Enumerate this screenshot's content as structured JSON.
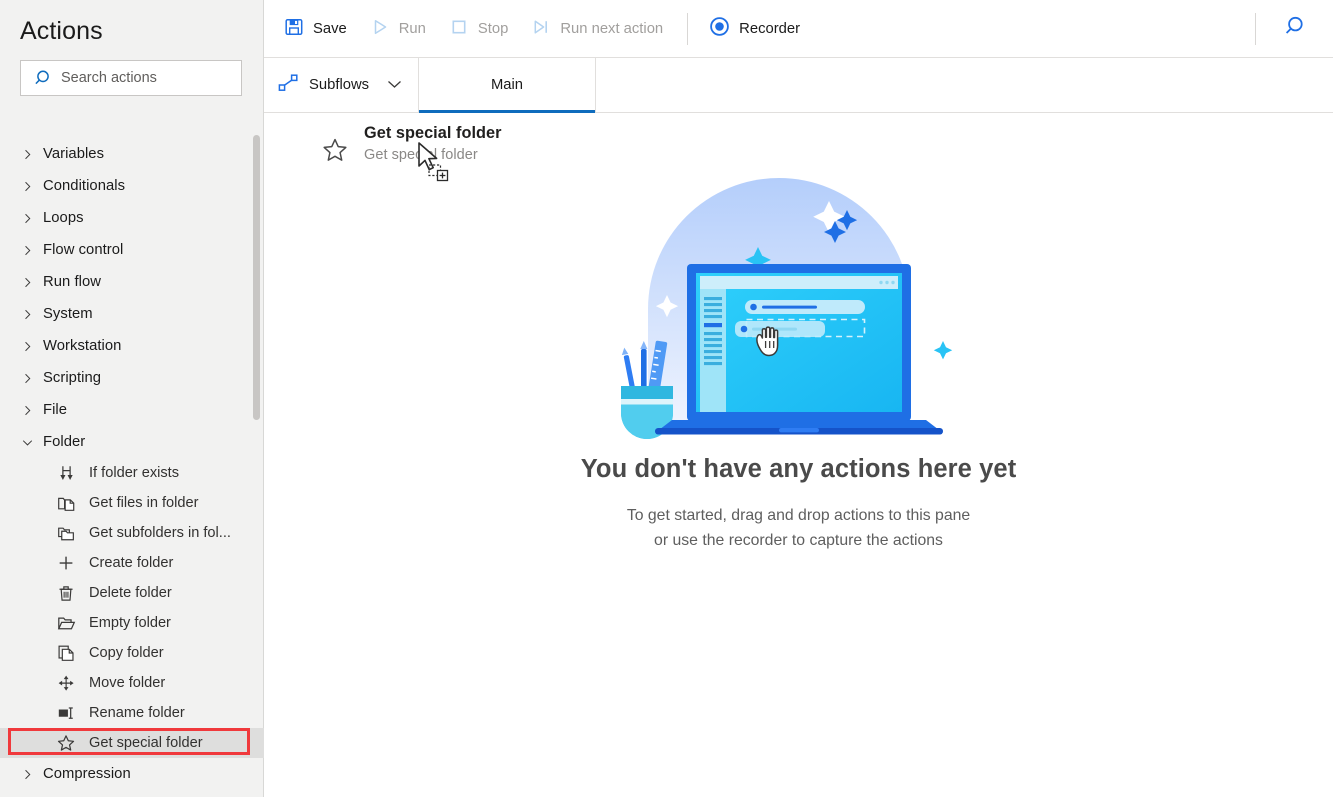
{
  "sidebar": {
    "title": "Actions",
    "search": {
      "placeholder": "Search actions",
      "value": "",
      "icon": "search-icon"
    },
    "scrollbar": {
      "visible": true
    },
    "groups": [
      {
        "label": "Variables",
        "expanded": false,
        "icon": "chevron-right-icon"
      },
      {
        "label": "Conditionals",
        "expanded": false,
        "icon": "chevron-right-icon"
      },
      {
        "label": "Loops",
        "expanded": false,
        "icon": "chevron-right-icon"
      },
      {
        "label": "Flow control",
        "expanded": false,
        "icon": "chevron-right-icon"
      },
      {
        "label": "Run flow",
        "expanded": false,
        "icon": "chevron-right-icon"
      },
      {
        "label": "System",
        "expanded": false,
        "icon": "chevron-right-icon"
      },
      {
        "label": "Workstation",
        "expanded": false,
        "icon": "chevron-right-icon"
      },
      {
        "label": "Scripting",
        "expanded": false,
        "icon": "chevron-right-icon"
      },
      {
        "label": "File",
        "expanded": false,
        "icon": "chevron-right-icon"
      },
      {
        "label": "Folder",
        "expanded": true,
        "icon": "chevron-down-icon"
      }
    ],
    "folder_actions": [
      {
        "label": "If folder exists",
        "icon": "branch-arrows-icon",
        "selected": false
      },
      {
        "label": "Get files in folder",
        "icon": "folder-file-icon",
        "selected": false
      },
      {
        "label": "Get subfolders in fol...",
        "icon": "folder-stack-icon",
        "selected": false
      },
      {
        "label": "Create folder",
        "icon": "plus-icon",
        "selected": false
      },
      {
        "label": "Delete folder",
        "icon": "trash-icon",
        "selected": false
      },
      {
        "label": "Empty folder",
        "icon": "open-folder-icon",
        "selected": false
      },
      {
        "label": "Copy folder",
        "icon": "copy-icon",
        "selected": false
      },
      {
        "label": "Move folder",
        "icon": "move-arrows-icon",
        "selected": false
      },
      {
        "label": "Rename folder",
        "icon": "rename-icon",
        "selected": false
      },
      {
        "label": "Get special folder",
        "icon": "star-icon",
        "selected": true
      }
    ],
    "trailing_groups": [
      {
        "label": "Compression",
        "expanded": false,
        "icon": "chevron-right-icon"
      }
    ],
    "highlight": {
      "target": "Get special folder",
      "color": "#f0393c"
    }
  },
  "toolbar": {
    "save_label": "Save",
    "save_icon": "save-disk-icon",
    "run_label": "Run",
    "run_icon": "play-triangle-icon",
    "stop_label": "Stop",
    "stop_icon": "stop-square-icon",
    "run_next_label": "Run next action",
    "run_next_icon": "play-step-icon",
    "recorder_label": "Recorder",
    "recorder_icon": "record-dot-icon",
    "search_icon": "search-icon"
  },
  "tabbar": {
    "subflows_label": "Subflows",
    "subflows_icon": "flow-nodes-icon",
    "subflows_chevron": "chevron-down-icon",
    "tabs": [
      {
        "label": "Main",
        "active": true
      }
    ]
  },
  "canvas": {
    "drag_ghost": {
      "title": "Get special folder",
      "subtitle": "Get special folder",
      "icon": "star-icon",
      "cursor": "drag-copy-cursor"
    },
    "empty_state": {
      "illustration": "laptop-drag-drop-illustration",
      "heading": "You don't have any actions here yet",
      "line1": "To get started, drag and drop actions to this pane",
      "line2": "or use the recorder to capture the actions"
    }
  },
  "colors": {
    "accent": "#0f6cbd",
    "accent_bright": "#2b88d8",
    "sidebar_bg": "#f2f2f1",
    "selected_row": "#dededd",
    "highlight_red": "#f0393c",
    "disabled_text": "#a19f9d",
    "illus_blue": "#1f6fe5",
    "illus_cyan": "#29c3f5"
  }
}
